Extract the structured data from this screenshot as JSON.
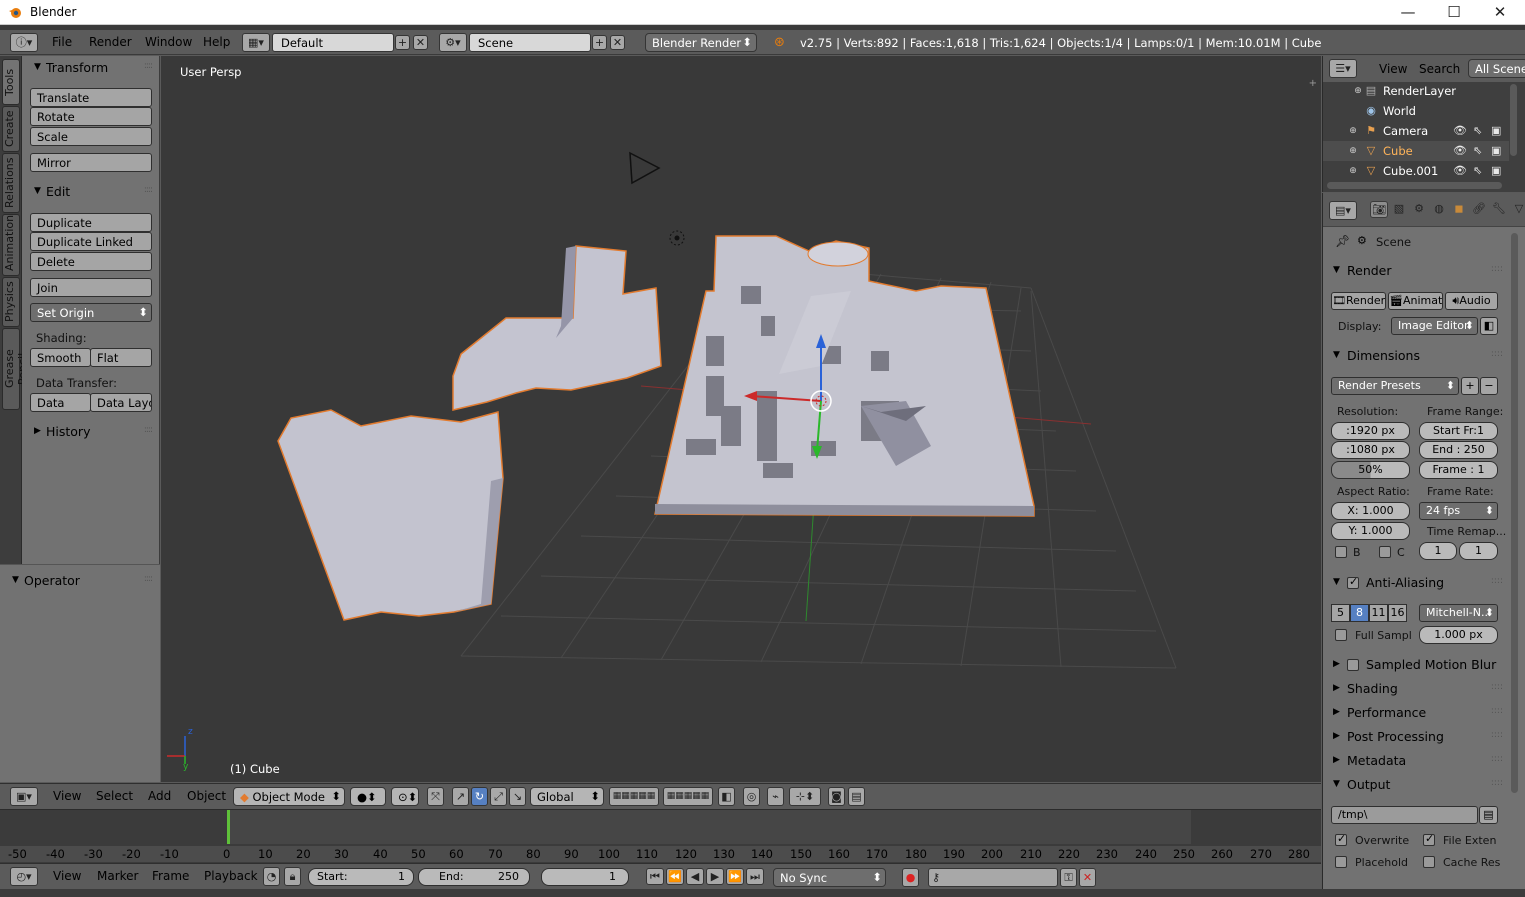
{
  "window": {
    "title": "Blender",
    "minimize": "—",
    "maximize": "☐",
    "close": "✕"
  },
  "topbar": {
    "menus": [
      "File",
      "Render",
      "Window",
      "Help"
    ],
    "layout": "Default",
    "scene": "Scene",
    "engine": "Blender Render",
    "stats": "v2.75 | Verts:892 | Faces:1,618 | Tris:1,624 | Objects:1/4 | Lamps:0/1 | Mem:10.01M | Cube"
  },
  "tooltabs": [
    "Tools",
    "Create",
    "Relations",
    "Animation",
    "Physics",
    "Grease Pencil"
  ],
  "toolshelf": {
    "transform": {
      "title": "Transform",
      "buttons": [
        "Translate",
        "Rotate",
        "Scale",
        "Mirror"
      ]
    },
    "edit": {
      "title": "Edit",
      "buttons": [
        "Duplicate",
        "Duplicate Linked",
        "Delete",
        "Join"
      ],
      "set_origin": "Set Origin"
    },
    "shading": {
      "label": "Shading:",
      "smooth": "Smooth",
      "flat": "Flat"
    },
    "data_transfer": {
      "label": "Data Transfer:",
      "data": "Data",
      "data_layout": "Data Layo"
    },
    "history": "History",
    "operator": "Operator"
  },
  "viewport": {
    "persp": "User Persp",
    "active_object": "(1) Cube",
    "axis_z": "z",
    "axis_y": "y"
  },
  "view3d_header": {
    "menus": [
      "View",
      "Select",
      "Add",
      "Object"
    ],
    "mode": "Object Mode",
    "orientation": "Global"
  },
  "timeline": {
    "ticks": [
      "-50",
      "-40",
      "-30",
      "-20",
      "-10",
      "0",
      "10",
      "20",
      "30",
      "40",
      "50",
      "60",
      "70",
      "80",
      "90",
      "100",
      "110",
      "120",
      "130",
      "140",
      "150",
      "160",
      "170",
      "180",
      "190",
      "200",
      "210",
      "220",
      "230",
      "240",
      "250",
      "260",
      "270",
      "280"
    ],
    "menus": [
      "View",
      "Marker",
      "Frame",
      "Playback"
    ],
    "start_label": "Start:",
    "start": "1",
    "end_label": "End:",
    "end": "250",
    "current": "1",
    "sync": "No Sync"
  },
  "outliner": {
    "menus": [
      "View",
      "Search"
    ],
    "filter": "All Scenes",
    "rows": [
      "RenderLayer",
      "World",
      "Camera",
      "Cube",
      "Cube.001"
    ]
  },
  "properties": {
    "context": "Scene",
    "render": {
      "title": "Render",
      "render_btn": "Render",
      "anim_btn": "Animati",
      "audio_btn": "Audio",
      "display_label": "Display:",
      "display": "Image Editor"
    },
    "dimensions": {
      "title": "Dimensions",
      "presets": "Render Presets",
      "resolution_label": "Resolution:",
      "res_x": ":1920 px",
      "res_y": ":1080 px",
      "res_pct": "50%",
      "frame_range_label": "Frame Range:",
      "start": "Start Fr:1",
      "end": "End : 250",
      "frame": "Frame : 1",
      "aspect_label": "Aspect Ratio:",
      "aspect_x": "X:  1.000",
      "aspect_y": "Y:  1.000",
      "frame_rate_label": "Frame Rate:",
      "fps": "24 fps",
      "time_remap_label": "Time Remap...",
      "remap_old": "1",
      "remap_new": "1",
      "border_b": "B",
      "border_c": "C"
    },
    "anti_aliasing": {
      "title": "Anti-Aliasing",
      "samples": [
        "5",
        "8",
        "11",
        "16"
      ],
      "filter": "Mitchell-N...",
      "full_sample": "Full Sampl",
      "filter_size": "1.000 px"
    },
    "collapsed": [
      "Sampled Motion Blur",
      "Shading",
      "Performance",
      "Post Processing",
      "Metadata"
    ],
    "output": {
      "title": "Output",
      "path": "/tmp\\",
      "overwrite": "Overwrite",
      "file_ext": "File Exten",
      "placeholders": "Placehold",
      "cache": "Cache Res"
    }
  },
  "colors": {
    "accent": "#5680c2",
    "selection_outline": "#e27b2f",
    "viewport_bg": "#393939",
    "panel_bg": "#727272"
  }
}
